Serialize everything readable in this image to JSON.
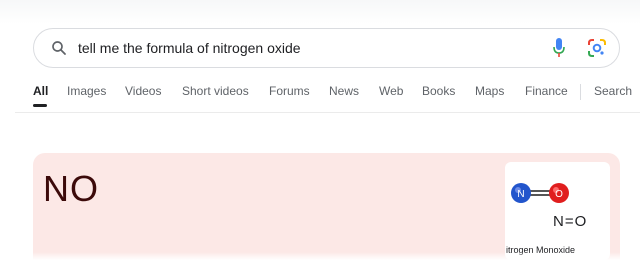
{
  "search": {
    "query": "tell me the formula of nitrogen oxide"
  },
  "tabs": [
    {
      "label": "All",
      "active": true
    },
    {
      "label": "Images"
    },
    {
      "label": "Videos"
    },
    {
      "label": "Short videos"
    },
    {
      "label": "Forums"
    },
    {
      "label": "News"
    },
    {
      "label": "Web"
    },
    {
      "label": "Books"
    },
    {
      "label": "Maps"
    },
    {
      "label": "Finance"
    },
    {
      "label": "Search"
    }
  ],
  "answer_card": {
    "answer": "NO",
    "structure_formula": "N=O",
    "atom_labels": [
      "N",
      "O"
    ],
    "caption": "itrogen Monoxide",
    "background_color": "#fce8e6"
  },
  "icons": {
    "search": "search-icon",
    "mic": "mic-icon",
    "lens": "google-lens-icon"
  }
}
